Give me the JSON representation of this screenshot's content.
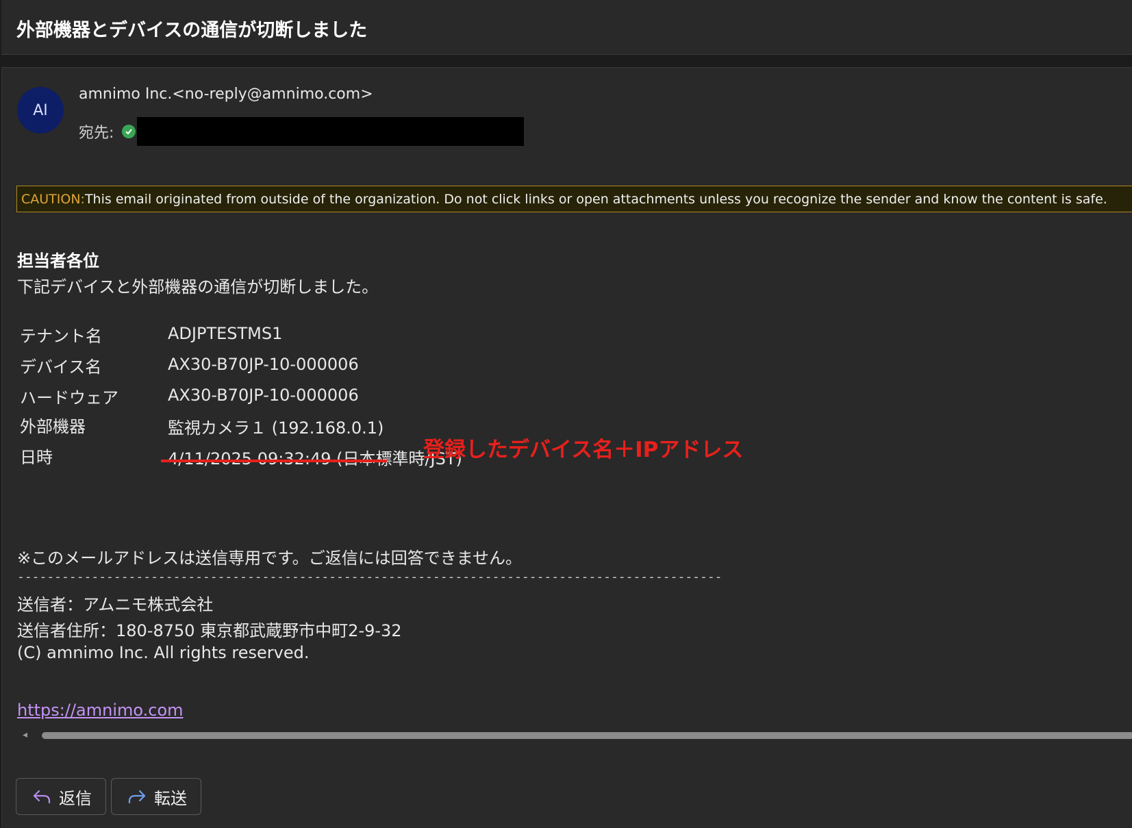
{
  "subject": "外部機器とデバイスの通信が切断しました",
  "avatar": {
    "initials": "AI",
    "color": "#0e1e66"
  },
  "sender": "amnimo Inc.<no-reply@amnimo.com>",
  "to_label": "宛先:",
  "caution": {
    "label": "CAUTION:",
    "text": " This email originated from outside of the organization. Do not click links or open attachments unless you recognize the sender and know the content is safe."
  },
  "body": {
    "greeting": "担当者各位",
    "intro": "下記デバイスと外部機器の通信が切断しました。",
    "info": [
      {
        "label": "テナント名",
        "value": "ADJPTESTMS1"
      },
      {
        "label": "デバイス名",
        "value": "AX30-B70JP-10-000006"
      },
      {
        "label": "ハードウェア",
        "value": "AX30-B70JP-10-000006"
      },
      {
        "label": "外部機器",
        "value": "監視カメラ１ (192.168.0.1)"
      },
      {
        "label": "日時",
        "value": "4/11/2025 09:32:49 (日本標準時/JST)"
      }
    ],
    "annotation": "登録したデバイス名＋IPアドレス",
    "notice": "※このメールアドレスは送信専用です。ご返信には回答できません。",
    "divider": "-----------------------------------------------------------------------------------------------",
    "footer": {
      "sender_line": "送信者：アムニモ株式会社",
      "address_line": "送信者住所：180-8750 東京都武蔵野市中町2-9-32",
      "copyright": "(C) amnimo Inc. All rights reserved.",
      "link": "https://amnimo.com"
    }
  },
  "actions": {
    "reply": "返信",
    "forward": "転送"
  },
  "colors": {
    "annotation": "#e8201c",
    "caution_label": "#e0a43a",
    "link": "#c493f5"
  }
}
